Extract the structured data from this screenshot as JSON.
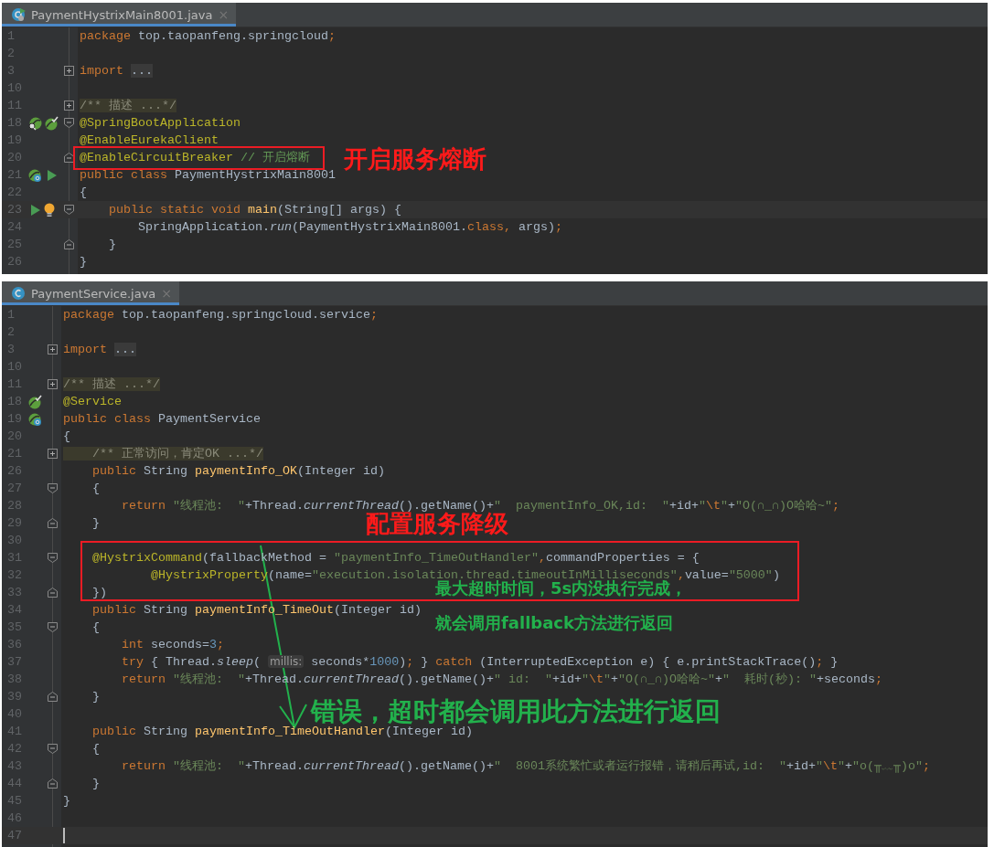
{
  "panels": [
    {
      "tab": {
        "label": "PaymentHystrixMain8001.java",
        "close": "×",
        "selected": true
      },
      "lines": [
        {
          "number": "1",
          "tokens": [
            {
              "kind": "keyword",
              "text": "package "
            },
            {
              "kind": "plain",
              "text": "top.taopanfeng.springcloud"
            },
            {
              "kind": "keyword",
              "text": ";"
            }
          ]
        },
        {
          "number": "2"
        },
        {
          "number": "3",
          "fold": {
            "kind": "collapsed"
          },
          "tokens": [
            {
              "kind": "keyword",
              "text": "import "
            },
            {
              "kind": "folded",
              "text": "..."
            }
          ]
        },
        {
          "number": "10"
        },
        {
          "number": "11",
          "fold": {
            "kind": "collapsed"
          },
          "tokens": [
            {
              "kind": "doc",
              "text": "/** 描述 ...*/"
            }
          ]
        },
        {
          "number": "18",
          "gutter": [
            {
              "kind": "bean-search"
            },
            {
              "kind": "bean-check"
            }
          ],
          "fold": {
            "kind": "start"
          },
          "tokens": [
            {
              "kind": "annotation",
              "text": "@SpringBootApplication"
            }
          ]
        },
        {
          "number": "19",
          "tokens": [
            {
              "kind": "annotation",
              "text": "@EnableEurekaClient"
            }
          ]
        },
        {
          "number": "20",
          "fold": {
            "kind": "end"
          },
          "tokens": [
            {
              "kind": "annotation",
              "text": "@EnableCircuitBreaker"
            },
            {
              "kind": "comment",
              "text": " // 开启熔断"
            }
          ]
        },
        {
          "number": "21",
          "gutter": [
            {
              "kind": "bean-class"
            },
            {
              "kind": "run"
            }
          ],
          "tokens": [
            {
              "kind": "keyword",
              "text": "public class "
            },
            {
              "kind": "plain",
              "text": "PaymentHystrixMain8001"
            }
          ]
        },
        {
          "number": "22",
          "tokens": [
            {
              "kind": "plain",
              "text": "{"
            }
          ]
        },
        {
          "number": "23",
          "gutter": [
            {
              "kind": "run"
            }
          ],
          "fold": {
            "kind": "start"
          },
          "current": true,
          "bulb": true,
          "tokens": [
            {
              "kind": "keyword",
              "text": "    public static void "
            },
            {
              "kind": "declaration",
              "text": "main"
            },
            {
              "kind": "plain",
              "text": "(String[] args) {"
            }
          ]
        },
        {
          "number": "24",
          "tokens": [
            {
              "kind": "plain",
              "text": "        SpringApplication."
            },
            {
              "kind": "italic",
              "text": "run"
            },
            {
              "kind": "plain",
              "text": "(PaymentHystrixMain8001."
            },
            {
              "kind": "keyword",
              "text": "class,"
            },
            {
              "kind": "plain",
              "text": " args)"
            },
            {
              "kind": "keyword",
              "text": ";"
            }
          ]
        },
        {
          "number": "25",
          "fold": {
            "kind": "end"
          },
          "tokens": [
            {
              "kind": "plain",
              "text": "    }"
            }
          ]
        },
        {
          "number": "26",
          "tokens": [
            {
              "kind": "plain",
              "text": "}"
            }
          ]
        }
      ],
      "callouts": [
        {
          "text": "开启服务熔断",
          "color": "#ff1a1a"
        }
      ]
    },
    {
      "tab": {
        "label": "PaymentService.java",
        "close": "×",
        "selected": true
      },
      "lines": [
        {
          "number": "1",
          "tokens": [
            {
              "kind": "keyword",
              "text": "package "
            },
            {
              "kind": "plain",
              "text": "top.taopanfeng.springcloud.service"
            },
            {
              "kind": "keyword",
              "text": ";"
            }
          ]
        },
        {
          "number": "2"
        },
        {
          "number": "3",
          "fold": {
            "kind": "collapsed"
          },
          "tokens": [
            {
              "kind": "keyword",
              "text": "import "
            },
            {
              "kind": "folded",
              "text": "..."
            }
          ]
        },
        {
          "number": "10"
        },
        {
          "number": "11",
          "fold": {
            "kind": "collapsed"
          },
          "tokens": [
            {
              "kind": "doc",
              "text": "/** 描述 ...*/"
            }
          ]
        },
        {
          "number": "18",
          "gutter": [
            {
              "kind": "bean-check"
            }
          ],
          "tokens": [
            {
              "kind": "annotation",
              "text": "@Service"
            }
          ]
        },
        {
          "number": "19",
          "gutter": [
            {
              "kind": "bean-class"
            }
          ],
          "tokens": [
            {
              "kind": "keyword",
              "text": "public class "
            },
            {
              "kind": "plain",
              "text": "PaymentService"
            }
          ]
        },
        {
          "number": "20",
          "tokens": [
            {
              "kind": "plain",
              "text": "{"
            }
          ]
        },
        {
          "number": "21",
          "fold": {
            "kind": "collapsed"
          },
          "tokens": [
            {
              "kind": "doc",
              "text": "    /** 正常访问，肯定OK ...*/"
            }
          ]
        },
        {
          "number": "26",
          "tokens": [
            {
              "kind": "keyword",
              "text": "    public "
            },
            {
              "kind": "plain",
              "text": "String "
            },
            {
              "kind": "declaration",
              "text": "paymentInfo_OK"
            },
            {
              "kind": "plain",
              "text": "(Integer id)"
            }
          ]
        },
        {
          "number": "27",
          "fold": {
            "kind": "start"
          },
          "tokens": [
            {
              "kind": "plain",
              "text": "    {"
            }
          ]
        },
        {
          "number": "28",
          "tokens": [
            {
              "kind": "keyword",
              "text": "        return "
            },
            {
              "kind": "string",
              "text": "\"线程池:  \""
            },
            {
              "kind": "plain",
              "text": "+Thread."
            },
            {
              "kind": "italic",
              "text": "currentThread"
            },
            {
              "kind": "plain",
              "text": "().getName()+"
            },
            {
              "kind": "string",
              "text": "\"  paymentInfo_OK,id:  \""
            },
            {
              "kind": "plain",
              "text": "+id+"
            },
            {
              "kind": "string",
              "text": "\""
            },
            {
              "kind": "escape",
              "text": "\\t"
            },
            {
              "kind": "string",
              "text": "\""
            },
            {
              "kind": "plain",
              "text": "+"
            },
            {
              "kind": "string",
              "text": "\"O(∩_∩)O哈哈~\""
            },
            {
              "kind": "keyword",
              "text": ";"
            }
          ]
        },
        {
          "number": "29",
          "fold": {
            "kind": "end"
          },
          "tokens": [
            {
              "kind": "plain",
              "text": "    }"
            }
          ]
        },
        {
          "number": "30"
        },
        {
          "number": "31",
          "fold": {
            "kind": "start"
          },
          "tokens": [
            {
              "kind": "annotation",
              "text": "    @HystrixCommand"
            },
            {
              "kind": "plain",
              "text": "(fallbackMethod = "
            },
            {
              "kind": "string",
              "text": "\"paymentInfo_TimeOutHandler\""
            },
            {
              "kind": "keyword",
              "text": ","
            },
            {
              "kind": "plain",
              "text": "commandProperties = {"
            }
          ]
        },
        {
          "number": "32",
          "tokens": [
            {
              "kind": "annotation",
              "text": "            @HystrixProperty"
            },
            {
              "kind": "plain",
              "text": "(name="
            },
            {
              "kind": "string",
              "text": "\"execution.isolation.thread.timeoutInMilliseconds\""
            },
            {
              "kind": "keyword",
              "text": ","
            },
            {
              "kind": "plain",
              "text": "value="
            },
            {
              "kind": "string",
              "text": "\"5000\""
            },
            {
              "kind": "plain",
              "text": ")"
            }
          ]
        },
        {
          "number": "33",
          "fold": {
            "kind": "end"
          },
          "tokens": [
            {
              "kind": "plain",
              "text": "    })"
            }
          ]
        },
        {
          "number": "34",
          "tokens": [
            {
              "kind": "keyword",
              "text": "    public "
            },
            {
              "kind": "plain",
              "text": "String "
            },
            {
              "kind": "declaration",
              "text": "paymentInfo_TimeOut"
            },
            {
              "kind": "plain",
              "text": "(Integer id)"
            }
          ]
        },
        {
          "number": "35",
          "fold": {
            "kind": "start"
          },
          "tokens": [
            {
              "kind": "plain",
              "text": "    {"
            }
          ]
        },
        {
          "number": "36",
          "tokens": [
            {
              "kind": "keyword",
              "text": "        int "
            },
            {
              "kind": "plain",
              "text": "seconds="
            },
            {
              "kind": "number",
              "text": "3"
            },
            {
              "kind": "keyword",
              "text": ";"
            }
          ]
        },
        {
          "number": "37",
          "tokens": [
            {
              "kind": "keyword",
              "text": "        try"
            },
            {
              "kind": "plain",
              "text": " { Thread."
            },
            {
              "kind": "italic",
              "text": "sleep"
            },
            {
              "kind": "plain",
              "text": "( "
            },
            {
              "kind": "hint",
              "text": "millis:"
            },
            {
              "kind": "plain",
              "text": " seconds*"
            },
            {
              "kind": "number",
              "text": "1000"
            },
            {
              "kind": "plain",
              "text": ")"
            },
            {
              "kind": "keyword",
              "text": ";"
            },
            {
              "kind": "plain",
              "text": " } "
            },
            {
              "kind": "keyword",
              "text": "catch"
            },
            {
              "kind": "plain",
              "text": " (InterruptedException e) { e.printStackTrace()"
            },
            {
              "kind": "keyword",
              "text": ";"
            },
            {
              "kind": "plain",
              "text": " }"
            }
          ]
        },
        {
          "number": "38",
          "tokens": [
            {
              "kind": "keyword",
              "text": "        return "
            },
            {
              "kind": "string",
              "text": "\"线程池:  \""
            },
            {
              "kind": "plain",
              "text": "+Thread."
            },
            {
              "kind": "italic",
              "text": "currentThread"
            },
            {
              "kind": "plain",
              "text": "().getName()+"
            },
            {
              "kind": "string",
              "text": "\" id:  \""
            },
            {
              "kind": "plain",
              "text": "+id+"
            },
            {
              "kind": "string",
              "text": "\""
            },
            {
              "kind": "escape",
              "text": "\\t"
            },
            {
              "kind": "string",
              "text": "\""
            },
            {
              "kind": "plain",
              "text": "+"
            },
            {
              "kind": "string",
              "text": "\"O(∩_∩)O哈哈~\""
            },
            {
              "kind": "plain",
              "text": "+"
            },
            {
              "kind": "string",
              "text": "\"  耗时(秒): \""
            },
            {
              "kind": "plain",
              "text": "+seconds"
            },
            {
              "kind": "keyword",
              "text": ";"
            }
          ]
        },
        {
          "number": "39",
          "fold": {
            "kind": "end"
          },
          "tokens": [
            {
              "kind": "plain",
              "text": "    }"
            }
          ]
        },
        {
          "number": "40"
        },
        {
          "number": "41",
          "tokens": [
            {
              "kind": "keyword",
              "text": "    public "
            },
            {
              "kind": "plain",
              "text": "String "
            },
            {
              "kind": "declaration",
              "text": "paymentInfo_TimeOutHandler"
            },
            {
              "kind": "plain",
              "text": "(Integer id)"
            }
          ]
        },
        {
          "number": "42",
          "fold": {
            "kind": "start"
          },
          "tokens": [
            {
              "kind": "plain",
              "text": "    {"
            }
          ]
        },
        {
          "number": "43",
          "tokens": [
            {
              "kind": "keyword",
              "text": "        return "
            },
            {
              "kind": "string",
              "text": "\"线程池:  \""
            },
            {
              "kind": "plain",
              "text": "+Thread."
            },
            {
              "kind": "italic",
              "text": "currentThread"
            },
            {
              "kind": "plain",
              "text": "().getName()+"
            },
            {
              "kind": "string",
              "text": "\"  8001系统繁忙或者运行报错，请稍后再试,id:  \""
            },
            {
              "kind": "plain",
              "text": "+id+"
            },
            {
              "kind": "string",
              "text": "\""
            },
            {
              "kind": "escape",
              "text": "\\t"
            },
            {
              "kind": "string",
              "text": "\""
            },
            {
              "kind": "plain",
              "text": "+"
            },
            {
              "kind": "string",
              "text": "\"o(╥﹏╥)o\""
            },
            {
              "kind": "keyword",
              "text": ";"
            }
          ]
        },
        {
          "number": "44",
          "fold": {
            "kind": "end"
          },
          "tokens": [
            {
              "kind": "plain",
              "text": "    }"
            }
          ]
        },
        {
          "number": "45",
          "tokens": [
            {
              "kind": "plain",
              "text": "}"
            }
          ]
        },
        {
          "number": "46"
        },
        {
          "number": "47",
          "current": true,
          "caret": true
        }
      ],
      "callouts": [
        {
          "text": "配置服务降级",
          "color": "#ff1a1a"
        },
        {
          "text": "最大超时时间，5s内没执行完成，",
          "color": "#22b14c"
        },
        {
          "text": "就会调用fallback方法进行返回",
          "color": "#22b14c"
        },
        {
          "text": "错误，超时都会调用此方法进行返回",
          "color": "#22b14c"
        }
      ]
    }
  ]
}
